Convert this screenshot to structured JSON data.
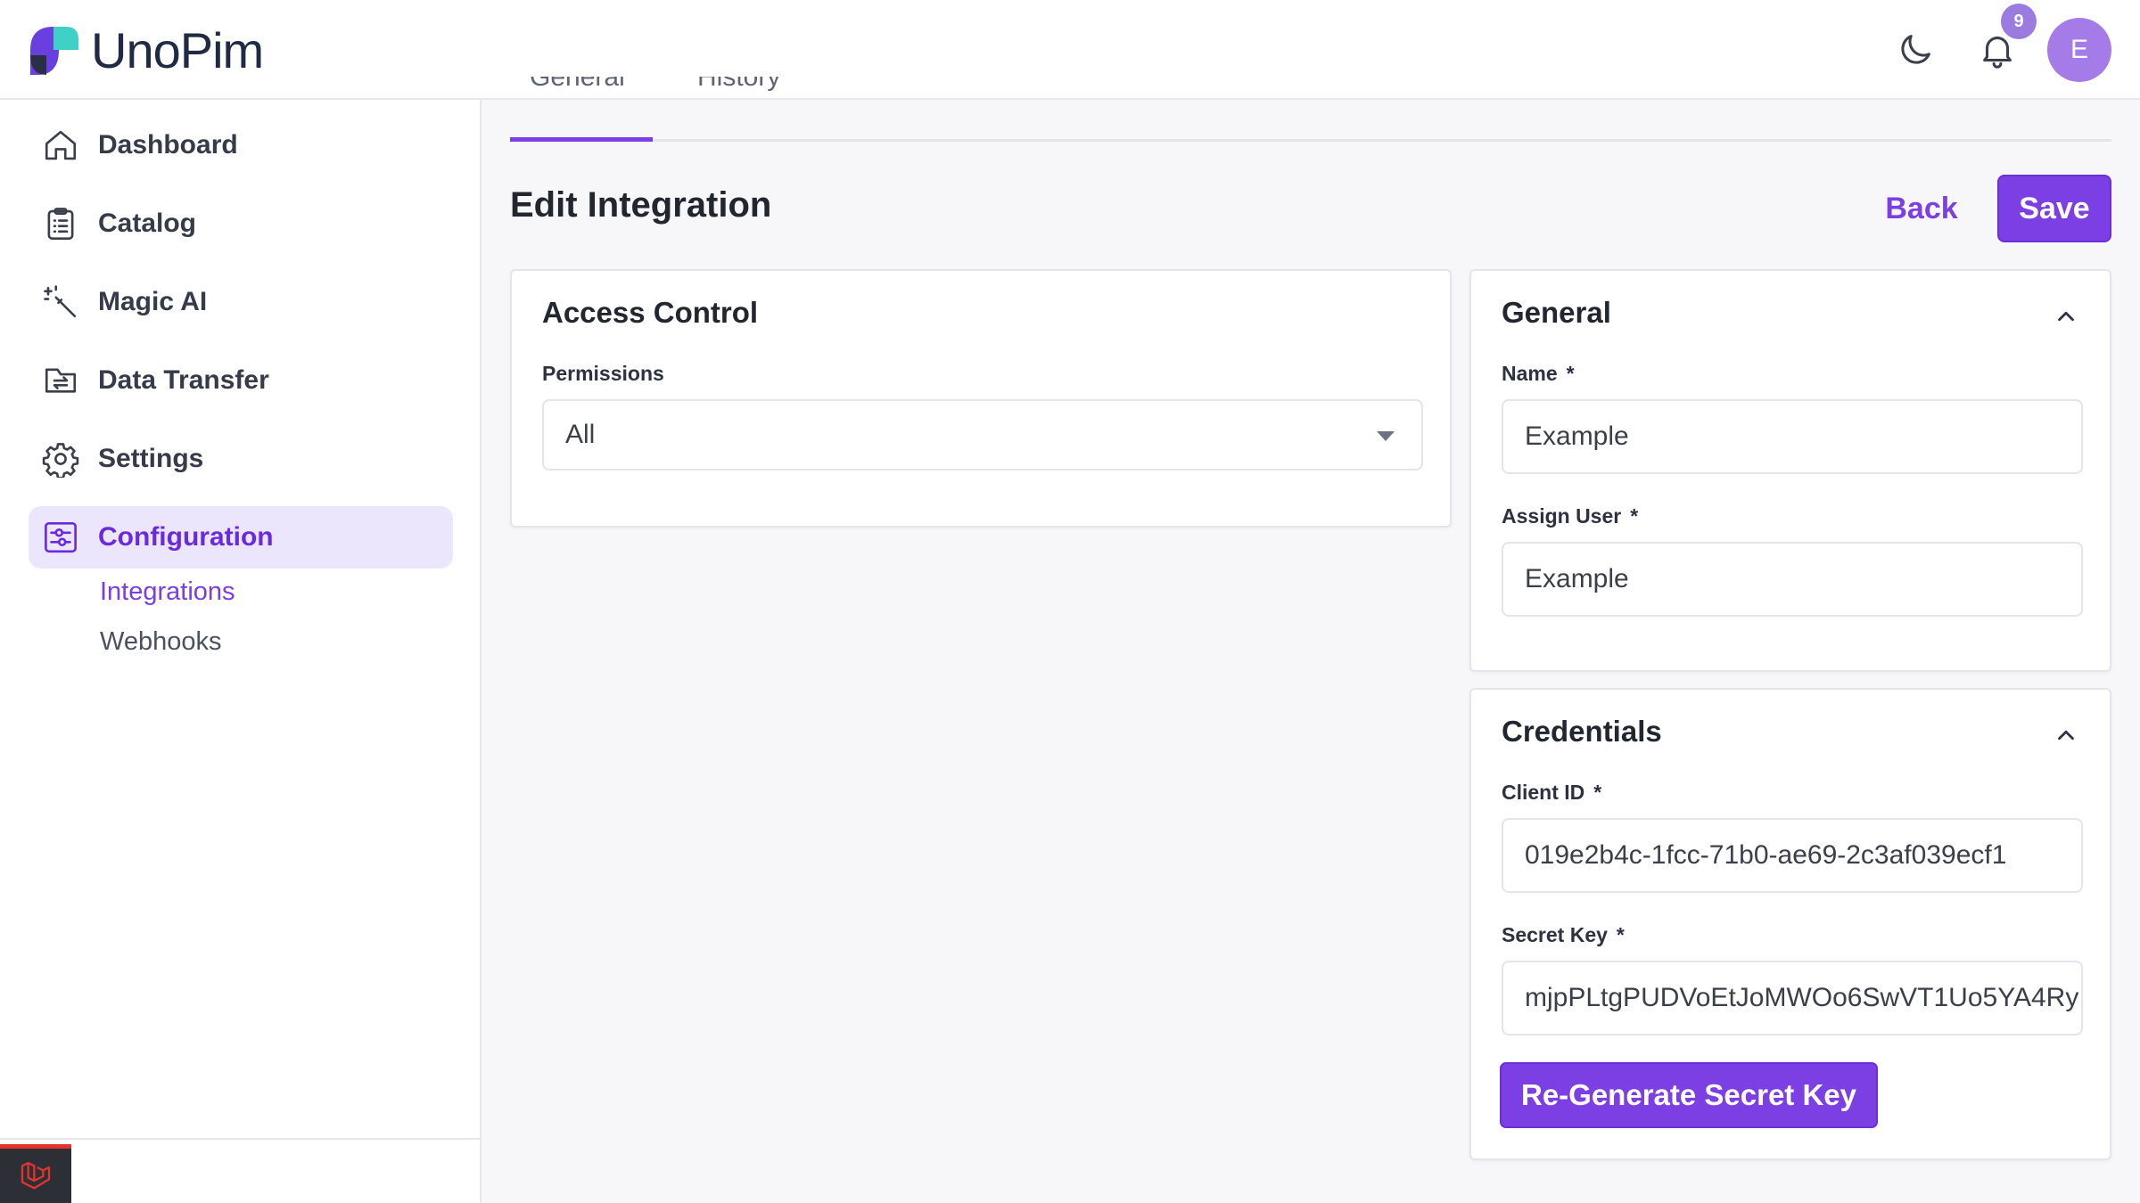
{
  "header": {
    "brand": "UnoPim",
    "notification_count": "9",
    "avatar_initial": "E"
  },
  "sidebar": {
    "items": [
      {
        "label": "Dashboard",
        "icon": "home-icon"
      },
      {
        "label": "Catalog",
        "icon": "clipboard-icon"
      },
      {
        "label": "Magic AI",
        "icon": "magic-wand-icon"
      },
      {
        "label": "Data Transfer",
        "icon": "data-transfer-icon"
      },
      {
        "label": "Settings",
        "icon": "gear-icon"
      },
      {
        "label": "Configuration",
        "icon": "sliders-icon",
        "active": true
      }
    ],
    "sub_items": [
      {
        "label": "Integrations",
        "active": true
      },
      {
        "label": "Webhooks",
        "active": false
      }
    ]
  },
  "tabs": [
    {
      "label": "General",
      "active": true
    },
    {
      "label": "History",
      "active": false
    }
  ],
  "page": {
    "title": "Edit Integration",
    "back_label": "Back",
    "save_label": "Save"
  },
  "access_control": {
    "title": "Access Control",
    "permissions_label": "Permissions",
    "permissions_value": "All"
  },
  "general": {
    "title": "General",
    "name_label": "Name",
    "name_value": "Example",
    "assign_user_label": "Assign User",
    "assign_user_value": "Example",
    "required_mark": "*"
  },
  "credentials": {
    "title": "Credentials",
    "client_id_label": "Client ID",
    "client_id_value": "019e2b4c-1fcc-71b0-ae69-2c3af039ecf1",
    "secret_key_label": "Secret Key",
    "secret_key_value": "mjpPLtgPUDVoEtJoMWOo6SwVT1Uo5YA4Ry",
    "regenerate_label": "Re-Generate Secret Key"
  },
  "colors": {
    "accent": "#7b3fe4",
    "active_bg": "#ece6fc",
    "badge": "#9b7be0",
    "avatar": "#a57be8"
  }
}
